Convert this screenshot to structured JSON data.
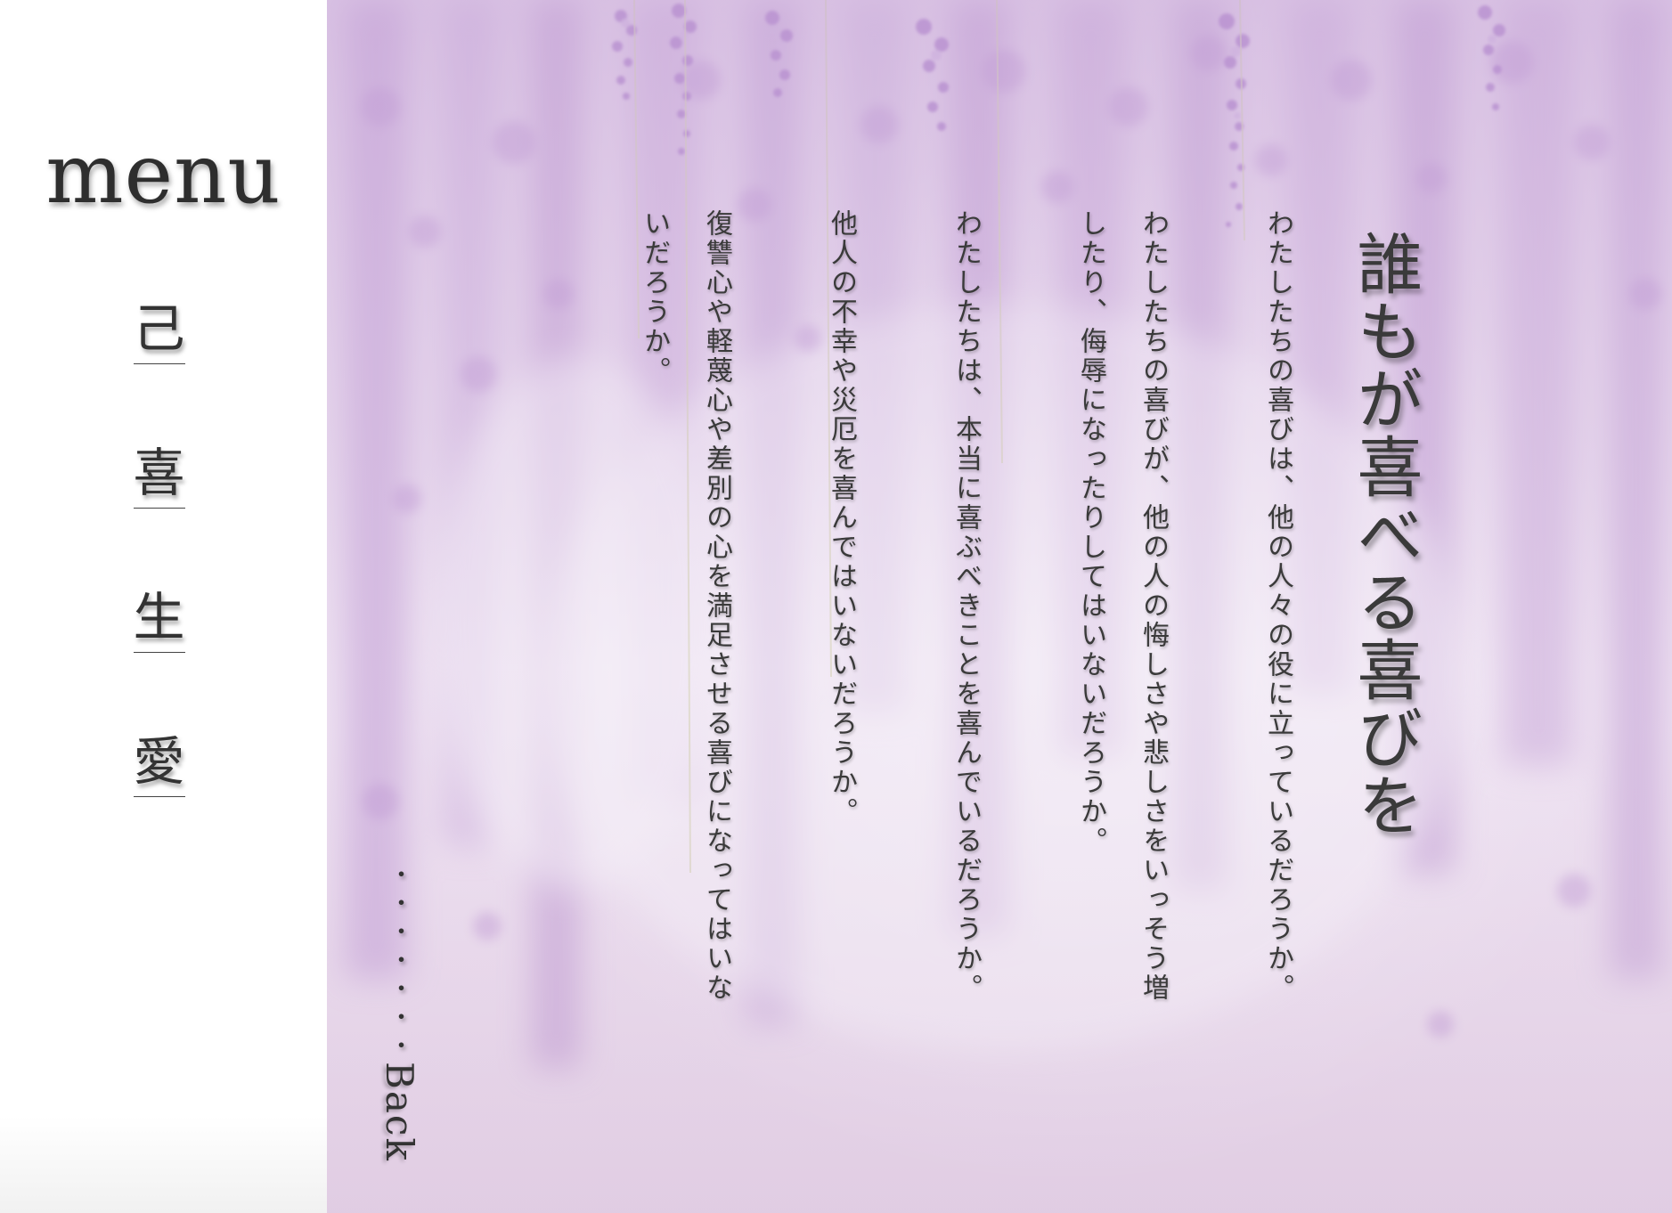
{
  "sidebar": {
    "title": "menu",
    "items": [
      {
        "label": "己"
      },
      {
        "label": "喜"
      },
      {
        "label": "生"
      },
      {
        "label": "愛"
      }
    ]
  },
  "main": {
    "heading": "誰もが喜べる喜びを",
    "paragraphs": [
      "わたしたちの喜びは、他の人々の役に立っているだろうか。",
      "わたしたちの喜びが、他の人の悔しさや悲しさをいっそう増したり、侮辱になったりしてはいないだろうか。",
      "わたしたちは、本当に喜ぶべきことを喜んでいるだろうか。",
      "他人の不幸や災厄を喜んではいないだろうか。",
      "復讐心や軽蔑心や差別の心を満足させる喜びになってはいないだろうか。"
    ],
    "back": {
      "dots": "・・・・・・・",
      "label": "Back"
    }
  },
  "colors": {
    "accent_lavender": "#e9d8ee",
    "text": "#333333",
    "sidebar_bg": "#ffffff"
  }
}
